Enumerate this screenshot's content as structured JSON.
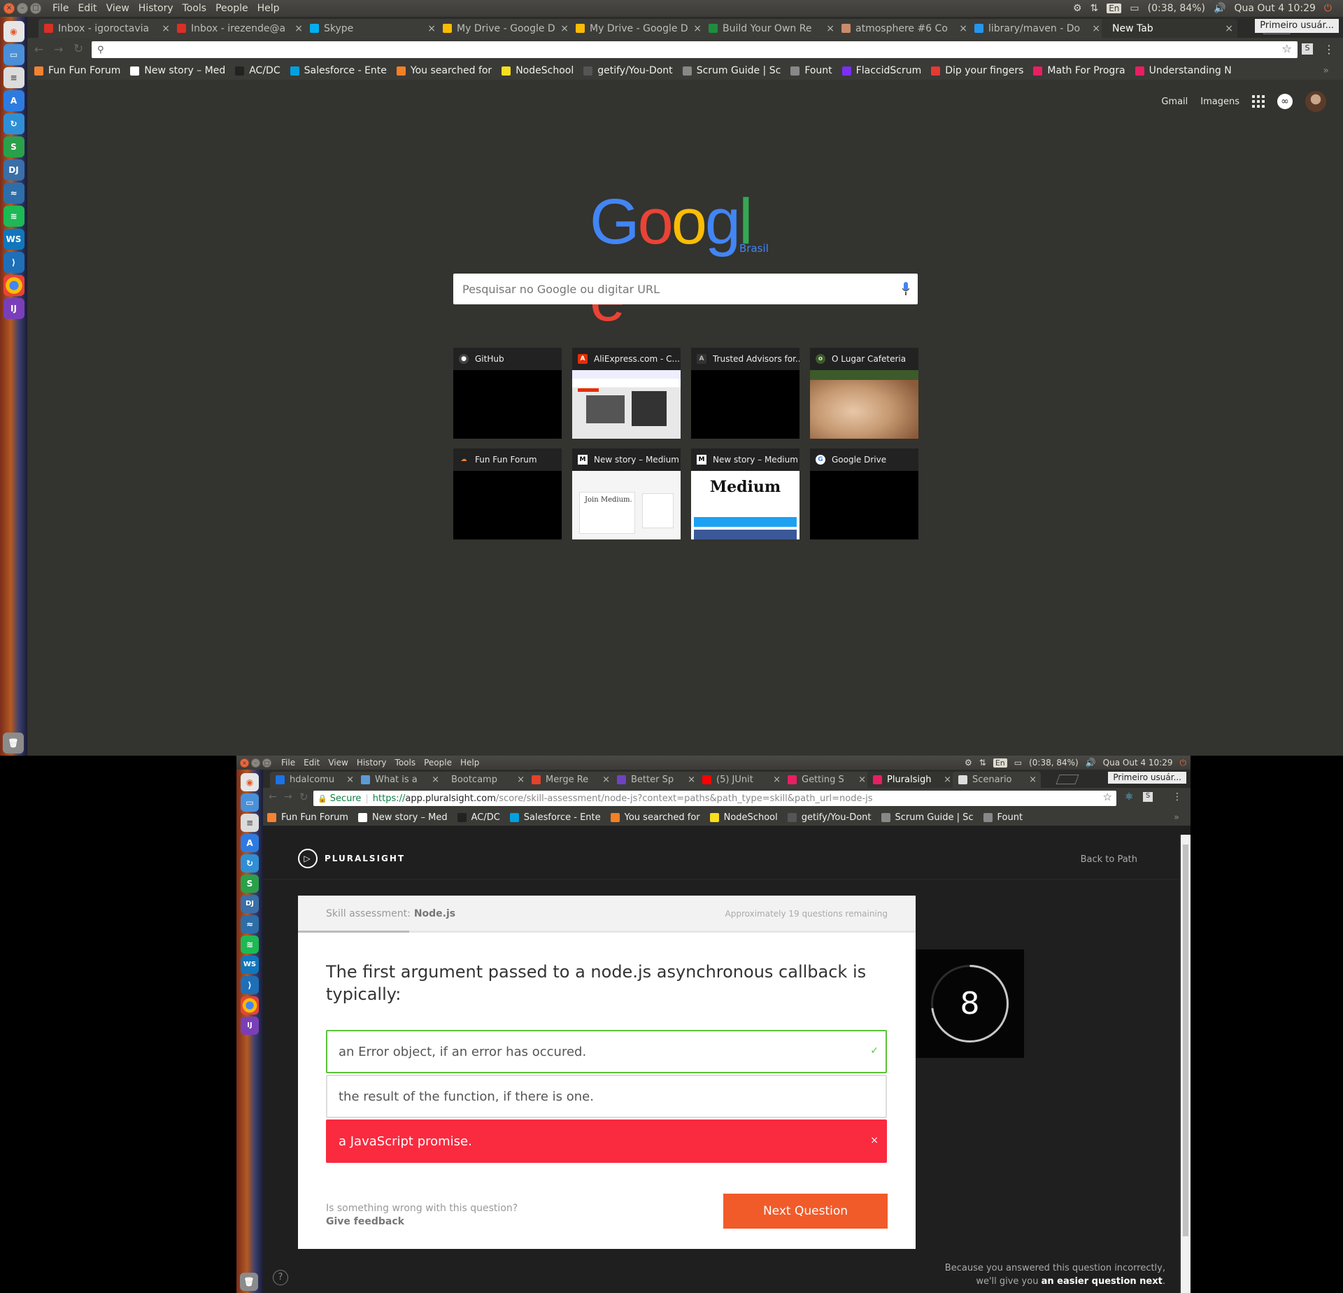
{
  "menu": {
    "items": [
      "File",
      "Edit",
      "View",
      "History",
      "Tools",
      "People",
      "Help"
    ]
  },
  "tray": {
    "lang": "En",
    "battery": "(0:38, 84%)",
    "datetime": "Qua Out  4 10:29"
  },
  "screen1": {
    "tabs": [
      {
        "label": "Inbox - igoroctavia",
        "color": "#d93025"
      },
      {
        "label": "Inbox - irezende@a",
        "color": "#d93025"
      },
      {
        "label": "Skype",
        "color": "#00aff0"
      },
      {
        "label": "My Drive - Google D",
        "color": "#fbbc04"
      },
      {
        "label": "My Drive - Google D",
        "color": "#fbbc04"
      },
      {
        "label": "Build Your Own Re",
        "color": "#1e8e3e"
      },
      {
        "label": "atmosphere #6 Co",
        "color": "#c98b6b"
      },
      {
        "label": "library/maven - Do",
        "color": "#2496ed"
      },
      {
        "label": "New Tab",
        "color": ""
      }
    ],
    "profile": "Primeiro usuár...",
    "bookmarks": [
      {
        "label": "Fun Fun Forum",
        "icon": "cloud-icon",
        "color": "#f58231"
      },
      {
        "label": "New story – Med",
        "icon": "medium-icon",
        "color": "#ffffff"
      },
      {
        "label": "AC/DC",
        "icon": "bolt-icon",
        "color": "#222222"
      },
      {
        "label": "Salesforce - Ente",
        "icon": "salesforce-icon",
        "color": "#00a1e0"
      },
      {
        "label": "You searched for",
        "icon": "search-result-icon",
        "color": "#f48024"
      },
      {
        "label": "NodeSchool",
        "icon": "nodeschool-icon",
        "color": "#f7df1e"
      },
      {
        "label": "getify/You-Dont",
        "icon": "github-icon",
        "color": "#555555"
      },
      {
        "label": "Scrum Guide | Sc",
        "icon": "page-icon",
        "color": "#888888"
      },
      {
        "label": "Fount",
        "icon": "page-icon",
        "color": "#888888"
      },
      {
        "label": "FlaccidScrum",
        "icon": "flaccid-icon",
        "color": "#7b2ff7"
      },
      {
        "label": "Dip your fingers",
        "icon": "target-icon",
        "color": "#e53935"
      },
      {
        "label": "Math For Progra",
        "icon": "pluralsight-icon",
        "color": "#e91e63"
      },
      {
        "label": "Understanding N",
        "icon": "pluralsight-icon",
        "color": "#e91e63"
      }
    ],
    "ntp": {
      "gmail": "Gmail",
      "images": "Imagens",
      "google": [
        "G",
        "o",
        "o",
        "g",
        "l",
        "e"
      ],
      "google_colors": [
        "#4285f4",
        "#ea4335",
        "#fbbc05",
        "#4285f4",
        "#34a853",
        "#ea4335"
      ],
      "google_sub": "Brasil",
      "search_placeholder": "Pesquisar no Google ou digitar URL",
      "tiles": [
        {
          "title": "GitHub",
          "icon": "github-icon"
        },
        {
          "title": "AliExpress.com - C...",
          "icon": "aliexpress-icon"
        },
        {
          "title": "Trusted Advisors for...",
          "icon": "page-icon"
        },
        {
          "title": "O Lugar Cafeteria",
          "icon": "cafe-icon"
        },
        {
          "title": "Fun Fun Forum",
          "icon": "cloud-icon"
        },
        {
          "title": "New story – Medium",
          "icon": "medium-icon"
        },
        {
          "title": "New story – Medium",
          "icon": "medium-icon"
        },
        {
          "title": "Google Drive",
          "icon": "google-icon"
        }
      ],
      "medium_word": "Medium",
      "join_medium": "Join Medium."
    }
  },
  "screen2": {
    "tabs": [
      {
        "label": "hdalcomu",
        "color": "#1a73e8"
      },
      {
        "label": "What is a",
        "color": "#5b9bd5"
      },
      {
        "label": "Bootcamp",
        "color": ""
      },
      {
        "label": "Merge Re",
        "color": "#e24329"
      },
      {
        "label": "Better Sp",
        "color": "#6f42c1"
      },
      {
        "label": "(5) JUnit",
        "color": "#ff0000"
      },
      {
        "label": "Getting S",
        "color": "#e91e63"
      },
      {
        "label": "Pluralsigh",
        "color": "#e91e63"
      },
      {
        "label": "Scenario",
        "color": "#dddddd"
      }
    ],
    "profile": "Primeiro usuár...",
    "url": {
      "secure": "Secure",
      "scheme": "https://",
      "host": "app.pluralsight.com",
      "path": "/score/skill-assessment/node-js?context=paths&path_type=skill&path_url=node-js"
    },
    "bookmarks": [
      {
        "label": "Fun Fun Forum",
        "icon": "cloud-icon",
        "color": "#f58231"
      },
      {
        "label": "New story – Med",
        "icon": "medium-icon",
        "color": "#ffffff"
      },
      {
        "label": "AC/DC",
        "icon": "bolt-icon",
        "color": "#222222"
      },
      {
        "label": "Salesforce - Ente",
        "icon": "salesforce-icon",
        "color": "#00a1e0"
      },
      {
        "label": "You searched for",
        "icon": "search-result-icon",
        "color": "#f48024"
      },
      {
        "label": "NodeSchool",
        "icon": "nodeschool-icon",
        "color": "#f7df1e"
      },
      {
        "label": "getify/You-Dont",
        "icon": "github-icon",
        "color": "#555555"
      },
      {
        "label": "Scrum Guide | Sc",
        "icon": "page-icon",
        "color": "#888888"
      },
      {
        "label": "Fount",
        "icon": "page-icon",
        "color": "#888888"
      }
    ],
    "ps": {
      "logo": "PLURALSIGHT",
      "back": "Back to Path",
      "assessment_prefix": "Skill assessment:",
      "assessment_name": "Node.js",
      "remaining": "Approximately 19 questions remaining",
      "progress": 0.18,
      "question": "The first argument passed to a node.js asynchronous callback is typically:",
      "answers": [
        {
          "text": "an Error object, if an error has occured.",
          "state": "correct",
          "mark": "✓"
        },
        {
          "text": "the result of the function, if there is one.",
          "state": "neutral",
          "mark": ""
        },
        {
          "text": "a JavaScript promise.",
          "state": "wrong",
          "mark": "×"
        }
      ],
      "feedback_q": "Is something wrong with this question?",
      "feedback_link": "Give feedback",
      "next": "Next Question",
      "timer": "8",
      "timer_fraction": 0.27,
      "note_line1": "Because you answered this question incorrectly,",
      "note_line2_prefix": "we'll give you",
      "note_line2_bold": "an easier question next",
      "note_line2_suffix": "."
    }
  },
  "colors": {
    "accent": "#f15b2a",
    "correct": "#5bc236",
    "wrong": "#fa2a3f"
  }
}
